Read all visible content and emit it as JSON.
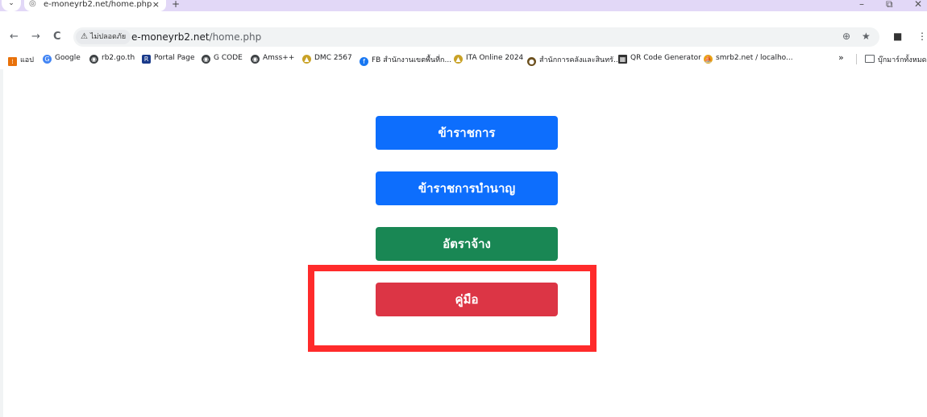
{
  "tab": {
    "title": "e-moneyrb2.net/home.php",
    "close": "×",
    "new_tab": "+"
  },
  "window": {
    "minimize": "–",
    "restore": "⧉",
    "close": "✕"
  },
  "toolbar": {
    "back": "←",
    "forward": "→",
    "reload": "C",
    "security_label": "ไม่ปลอดภัย",
    "url_host": "e-moneyrb2.net",
    "url_path": "/home.php"
  },
  "bookmarks": [
    {
      "label": "แอป",
      "icon": "apps-grid-icon",
      "color": "#e8710a"
    },
    {
      "label": "Google",
      "icon": "google-icon",
      "color": "#4285f4"
    },
    {
      "label": "rb2.go.th",
      "icon": "globe-icon",
      "color": "#3c4043"
    },
    {
      "label": "Portal Page",
      "icon": "portal-r-icon",
      "color": "#1a3a8a"
    },
    {
      "label": "G CODE",
      "icon": "globe-icon",
      "color": "#3c4043"
    },
    {
      "label": "Amss++",
      "icon": "globe-icon",
      "color": "#3c4043"
    },
    {
      "label": "DMC 2567",
      "icon": "medal-icon",
      "color": "#c9a227"
    },
    {
      "label": "FB สำนักงานเขตพื้นที่ก...",
      "icon": "facebook-icon",
      "color": "#1877f2"
    },
    {
      "label": "ITA Online 2024",
      "icon": "medal-icon",
      "color": "#c9a227"
    },
    {
      "label": "สำนักการคลังและสินทรั...",
      "icon": "emblem-icon",
      "color": "#6b4f1d"
    },
    {
      "label": "QR Code Generator",
      "icon": "qr-icon",
      "color": "#333333"
    },
    {
      "label": "smrb2.net / localho...",
      "icon": "phpmyadmin-icon",
      "color": "#e8a317"
    }
  ],
  "bookmarks_overflow": "»",
  "other_bookmarks": "บุ๊กมาร์กทั้งหมด",
  "menu": {
    "buttons": [
      {
        "label": "ข้าราชการ",
        "color": "#0d6efd"
      },
      {
        "label": "ข้าราชการบำนาญ",
        "color": "#0d6efd"
      },
      {
        "label": "อัตราจ้าง",
        "color": "#198754"
      },
      {
        "label": "คู่มือ",
        "color": "#dc3545"
      }
    ]
  },
  "highlight_color": "#ff2b2b"
}
